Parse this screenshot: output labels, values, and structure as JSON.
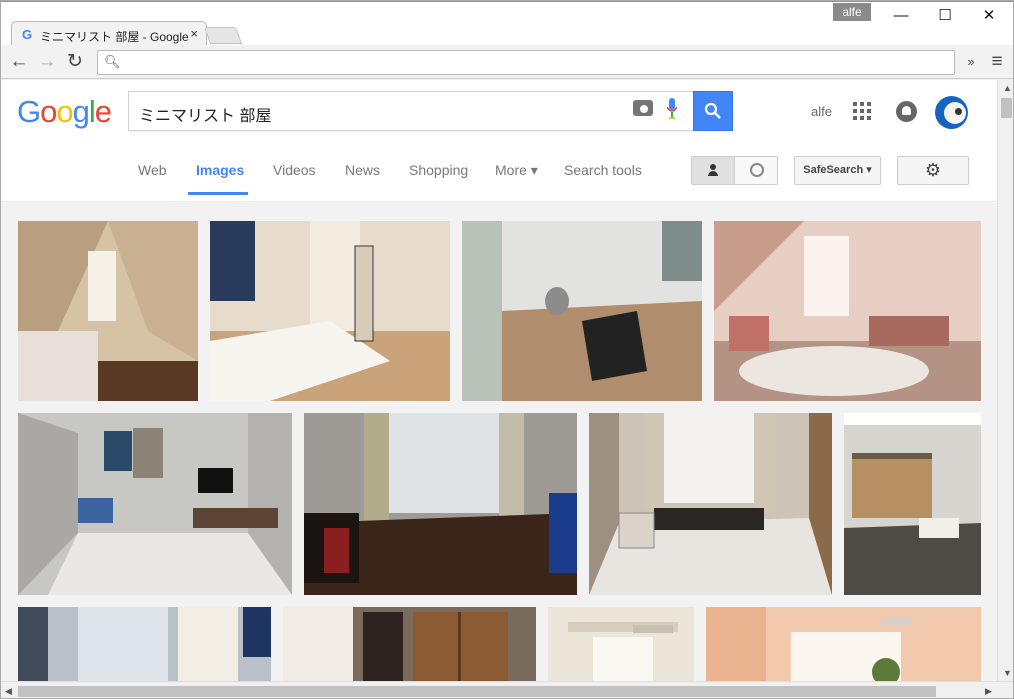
{
  "browser": {
    "tab_title": "ミニマリスト 部屋 - Google S",
    "tab_close": "×",
    "user_badge": "alfe",
    "window_controls": {
      "minimize": "—",
      "maximize": "☐",
      "close": "✕"
    },
    "omnibox_value": "",
    "extensions_glyph": "»",
    "menu_glyph": "≡"
  },
  "google": {
    "logo_letters": [
      "G",
      "o",
      "o",
      "g",
      "l",
      "e"
    ],
    "logo_colors": [
      "#4285f4",
      "#ea4335",
      "#fbbc05",
      "#4285f4",
      "#34a853",
      "#ea4335"
    ],
    "query": "ミニマリスト 部屋",
    "user_name": "alfe",
    "tabs": [
      "Web",
      "Images",
      "Videos",
      "News",
      "Shopping",
      "More ▾",
      "Search tools"
    ],
    "active_tab": "Images",
    "safesearch_label": "SafeSearch ▾",
    "settings_glyph": "⚙"
  },
  "results": {
    "row1_colors": [
      "#d6c3a6",
      "#e7dccc",
      "#c9c6bf",
      "#e6cfc2"
    ],
    "row2_colors": [
      "#c7c7c4",
      "#6c5a4a",
      "#cdc4b7",
      "#8e8a83"
    ],
    "row3_colors": [
      "#b9c0c8",
      "#7b6b5c",
      "#ece6da",
      "#f1c9ad"
    ]
  }
}
